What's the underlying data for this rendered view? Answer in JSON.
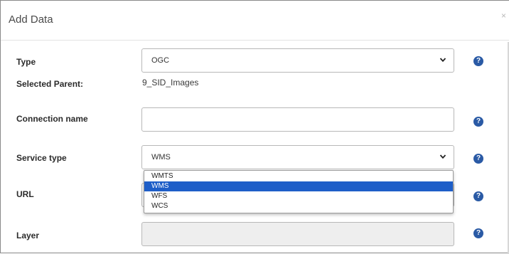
{
  "dialog": {
    "title": "Add Data",
    "close_symbol": "×"
  },
  "form": {
    "type": {
      "label": "Type",
      "value": "OGC"
    },
    "selected_parent": {
      "label": "Selected Parent:",
      "value": "9_SID_Images"
    },
    "connection_name": {
      "label": "Connection name",
      "value": ""
    },
    "service_type": {
      "label": "Service type",
      "value": "WMS",
      "options": [
        "WMTS",
        "WMS",
        "WFS",
        "WCS"
      ],
      "selected_index": 1
    },
    "url": {
      "label": "URL",
      "value": ""
    },
    "layer": {
      "label": "Layer",
      "value": ""
    }
  },
  "help_symbol": "?",
  "icons": {
    "help": "question-circle-icon",
    "dropdown": "chevron-down-icon",
    "close": "close-icon"
  },
  "colors": {
    "accent": "#2a5aa5",
    "selected_option": "#1e5ec8"
  }
}
